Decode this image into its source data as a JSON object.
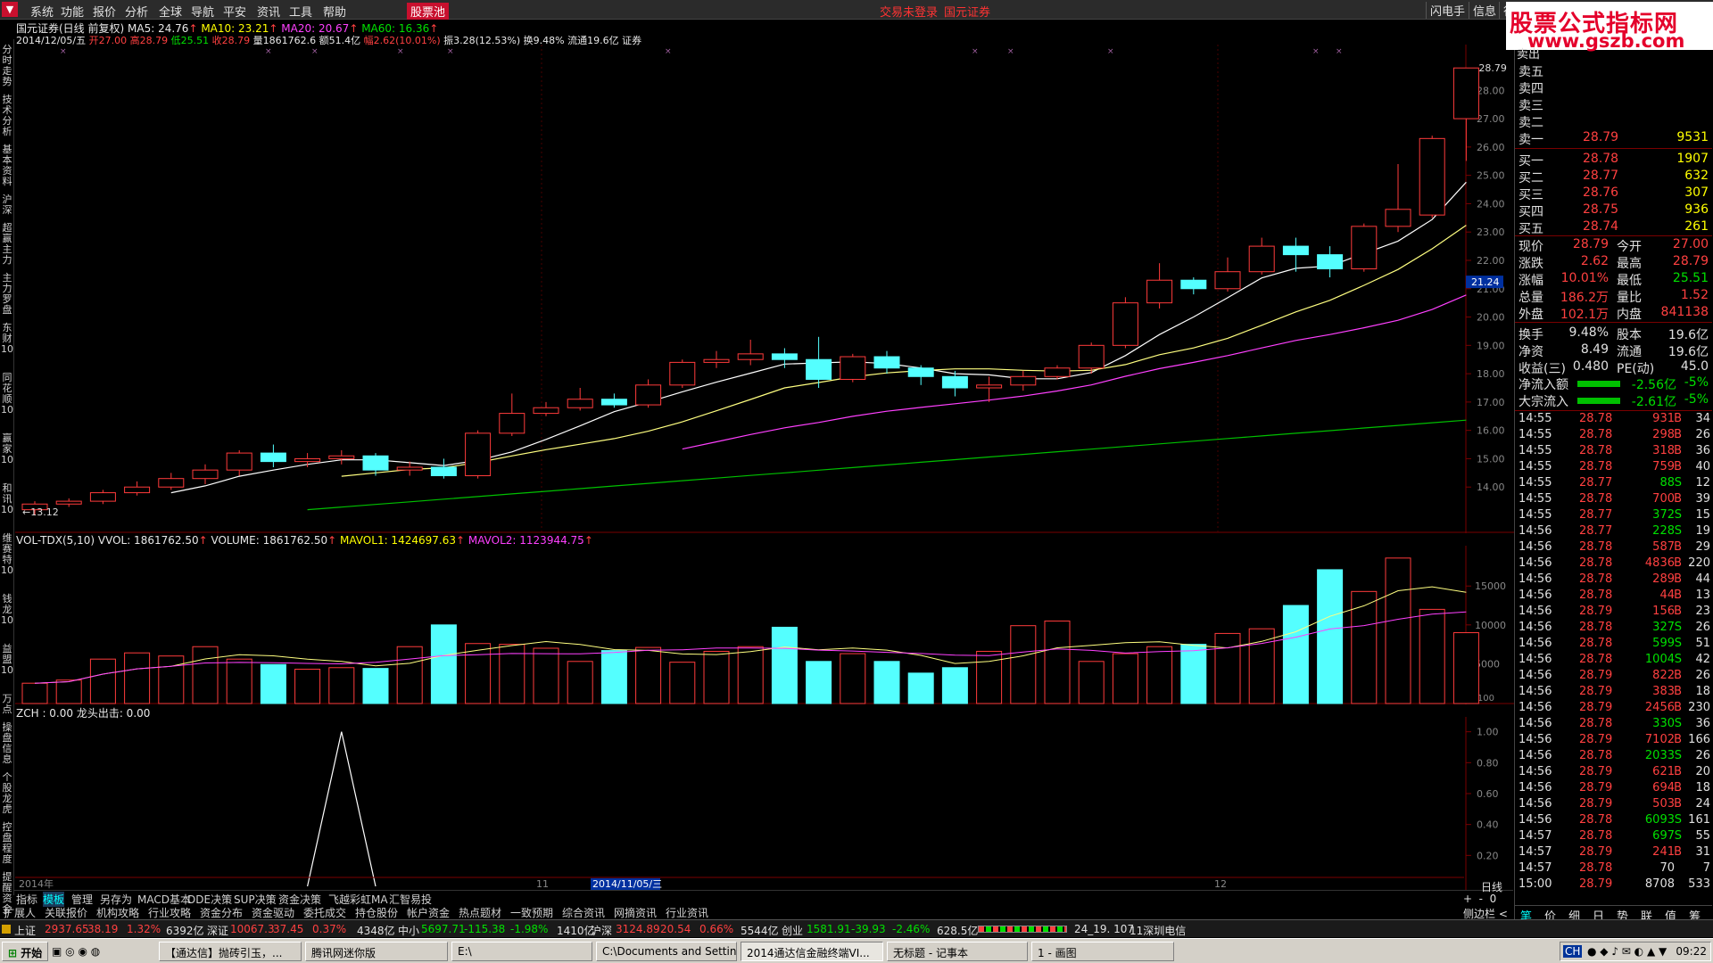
{
  "menu": {
    "items": [
      "系统",
      "功能",
      "报价",
      "分析",
      "全球",
      "导航",
      "平安",
      "资讯",
      "工具",
      "帮助"
    ],
    "active_label": "股票池",
    "status_text": "交易未登录",
    "broker_text": "国元证券",
    "right_buttons": [
      "闪电手",
      "信息",
      "行"
    ]
  },
  "watermark": {
    "line1": "股票公式指标网",
    "line2": "www.gszb.com"
  },
  "stock_header": {
    "name_ma": "国元证券(日线 前复权)",
    "ma5": "MA5: 24.76",
    "ma10": "MA10: 23.21",
    "ma20": "MA20: 20.67",
    "ma60": "MA60: 16.36",
    "date": "2014/12/05/五",
    "open": "开27.00",
    "high": "高28.79",
    "low": "低25.51",
    "close": "收28.79",
    "vol": "量1861762.6",
    "amount": "额51.4亿",
    "change": "幅2.62(10.01%)",
    "amp": "振3.28(12.53%)",
    "turn": "换9.48%",
    "float": "流通19.6亿",
    "sector": "证券"
  },
  "vol_header": {
    "title": "VOL-TDX(5,10)",
    "vvol": "VVOL: 1861762.50",
    "volume": "VOLUME: 1861762.50",
    "mavol1": "MAVOL1: 1424697.63",
    "mavol2": "MAVOL2: 1123944.75"
  },
  "zch_header": {
    "text": "ZCH : 0.00  龙头出击: 0.00"
  },
  "left_tabs": [
    "分时走势",
    "技术分析",
    "基本资料",
    "沪深",
    "超赢主力",
    "主力罗盘",
    "东财10",
    "同花顺10",
    "赢家10",
    "和讯10",
    "维赛特10",
    "钱龙10",
    "益盟10",
    "万点",
    "操盘信息",
    "个股龙虎",
    "控盘程度",
    "提醒资金"
  ],
  "chart_price": {
    "type": "candlestick",
    "y_ticks": [
      "28.00",
      "27.00",
      "26.00",
      "25.00",
      "24.00",
      "23.00",
      "22.00",
      "21.00",
      "20.00",
      "19.00",
      "18.00",
      "17.00",
      "16.00",
      "15.00",
      "14.00"
    ],
    "ylim": [
      13.0,
      29.3
    ],
    "high_label": "28.79",
    "low_label": "←13.12",
    "cursor_label": "21.24",
    "x_labels": [
      "2014年",
      "11",
      "2014/11/05/三",
      "12"
    ],
    "candles": [
      [
        13.2,
        13.4,
        13.0,
        13.5
      ],
      [
        13.4,
        13.5,
        13.3,
        13.6
      ],
      [
        13.5,
        13.8,
        13.4,
        13.9
      ],
      [
        13.8,
        14.0,
        13.7,
        14.2
      ],
      [
        14.0,
        14.3,
        13.9,
        14.5
      ],
      [
        14.3,
        14.6,
        14.1,
        14.8
      ],
      [
        14.6,
        15.2,
        14.4,
        15.3
      ],
      [
        15.2,
        14.9,
        14.7,
        15.5
      ],
      [
        14.9,
        15.0,
        14.7,
        15.2
      ],
      [
        15.0,
        15.1,
        14.8,
        15.3
      ],
      [
        15.1,
        14.6,
        14.4,
        15.2
      ],
      [
        14.6,
        14.7,
        14.4,
        14.9
      ],
      [
        14.7,
        14.4,
        14.3,
        15.0
      ],
      [
        14.4,
        15.9,
        14.3,
        16.0
      ],
      [
        15.9,
        16.6,
        15.8,
        17.3
      ],
      [
        16.6,
        16.8,
        16.5,
        17.0
      ],
      [
        16.8,
        17.1,
        16.7,
        17.5
      ],
      [
        17.1,
        16.9,
        16.8,
        17.3
      ],
      [
        16.9,
        17.6,
        16.8,
        17.8
      ],
      [
        17.6,
        18.4,
        17.5,
        18.5
      ],
      [
        18.4,
        18.5,
        18.2,
        18.8
      ],
      [
        18.5,
        18.7,
        18.3,
        19.2
      ],
      [
        18.7,
        18.5,
        18.2,
        18.9
      ],
      [
        18.5,
        17.8,
        17.5,
        19.3
      ],
      [
        17.8,
        18.6,
        17.7,
        18.7
      ],
      [
        18.6,
        18.2,
        18.0,
        18.8
      ],
      [
        18.2,
        17.9,
        17.6,
        18.3
      ],
      [
        17.9,
        17.5,
        17.2,
        18.1
      ],
      [
        17.5,
        17.6,
        17.0,
        17.9
      ],
      [
        17.6,
        17.9,
        17.4,
        18.1
      ],
      [
        17.9,
        18.2,
        17.8,
        18.3
      ],
      [
        18.2,
        19.0,
        18.0,
        19.1
      ],
      [
        19.0,
        20.5,
        18.9,
        20.7
      ],
      [
        20.5,
        21.3,
        20.3,
        21.9
      ],
      [
        21.3,
        21.0,
        20.8,
        21.4
      ],
      [
        21.0,
        21.6,
        20.9,
        22.1
      ],
      [
        21.6,
        22.5,
        21.5,
        22.8
      ],
      [
        22.5,
        22.2,
        21.6,
        22.8
      ],
      [
        22.2,
        21.7,
        21.4,
        22.5
      ],
      [
        21.7,
        23.2,
        21.6,
        23.3
      ],
      [
        23.2,
        23.8,
        23.0,
        25.4
      ],
      [
        23.6,
        26.3,
        23.5,
        26.4
      ],
      [
        27.0,
        28.79,
        25.51,
        28.79
      ]
    ]
  },
  "chart_volume": {
    "type": "bar",
    "y_ticks": [
      "15000",
      "10000",
      "5000"
    ],
    "unit": "X100",
    "values": [
      2500,
      2900,
      5600,
      6400,
      6000,
      7200,
      5600,
      4900,
      4300,
      4500,
      4400,
      7200,
      10000,
      7600,
      7500,
      7000,
      5300,
      6700,
      7100,
      5200,
      6600,
      7200,
      9700,
      5300,
      6300,
      5300,
      3800,
      4500,
      6600,
      9900,
      10500,
      5300,
      6300,
      7200,
      7500,
      8900,
      9500,
      12500,
      17100,
      14300,
      18600,
      12000,
      9000
    ]
  },
  "chart_zch": {
    "type": "line",
    "y_ticks": [
      "1.00",
      "0.80",
      "0.60",
      "0.40",
      "0.20"
    ]
  },
  "quote": {
    "sell_top": "卖出",
    "sell": [
      {
        "label": "卖五",
        "price": "",
        "vol": ""
      },
      {
        "label": "卖四",
        "price": "",
        "vol": ""
      },
      {
        "label": "卖三",
        "price": "",
        "vol": ""
      },
      {
        "label": "卖二",
        "price": "",
        "vol": ""
      },
      {
        "label": "卖一",
        "price": "28.79",
        "vol": "9531"
      }
    ],
    "buy": [
      {
        "label": "买一",
        "price": "28.78",
        "vol": "1907"
      },
      {
        "label": "买二",
        "price": "28.77",
        "vol": "632"
      },
      {
        "label": "买三",
        "price": "28.76",
        "vol": "307"
      },
      {
        "label": "买四",
        "price": "28.75",
        "vol": "936"
      },
      {
        "label": "买五",
        "price": "28.74",
        "vol": "261"
      }
    ],
    "stats": [
      {
        "l1": "现价",
        "v1": "28.79",
        "l2": "今开",
        "v2": "27.00"
      },
      {
        "l1": "涨跌",
        "v1": "2.62",
        "l2": "最高",
        "v2": "28.79"
      },
      {
        "l1": "涨幅",
        "v1": "10.01%",
        "l2": "最低",
        "v2": "25.51"
      },
      {
        "l1": "总量",
        "v1": "186.2万",
        "l2": "量比",
        "v2": "1.52"
      },
      {
        "l1": "外盘",
        "v1": "102.1万",
        "l2": "内盘",
        "v2": "841138"
      },
      {
        "l1": "换手",
        "v1": "9.48%",
        "l2": "股本",
        "v2": "19.6亿"
      },
      {
        "l1": "净资",
        "v1": "8.49",
        "l2": "流通",
        "v2": "19.6亿"
      },
      {
        "l1": "收益(三)",
        "v1": "0.480",
        "l2": "PE(动)",
        "v2": "45.0"
      }
    ],
    "flow": [
      {
        "label": "净流入额",
        "value": "-2.56亿",
        "pct": "-5%"
      },
      {
        "label": "大宗流入",
        "value": "-2.61亿",
        "pct": "-5%"
      }
    ],
    "ticks": [
      [
        "14:55",
        "28.78",
        "931",
        "B",
        "34"
      ],
      [
        "14:55",
        "28.78",
        "298",
        "B",
        "26"
      ],
      [
        "14:55",
        "28.78",
        "318",
        "B",
        "36"
      ],
      [
        "14:55",
        "28.78",
        "759",
        "B",
        "40"
      ],
      [
        "14:55",
        "28.77",
        "88",
        "S",
        "12"
      ],
      [
        "14:55",
        "28.78",
        "700",
        "B",
        "39"
      ],
      [
        "14:55",
        "28.77",
        "372",
        "S",
        "15"
      ],
      [
        "14:56",
        "28.77",
        "228",
        "S",
        "19"
      ],
      [
        "14:56",
        "28.78",
        "587",
        "B",
        "29"
      ],
      [
        "14:56",
        "28.78",
        "4836",
        "B",
        "220"
      ],
      [
        "14:56",
        "28.78",
        "289",
        "B",
        "44"
      ],
      [
        "14:56",
        "28.78",
        "44",
        "B",
        "13"
      ],
      [
        "14:56",
        "28.79",
        "156",
        "B",
        "23"
      ],
      [
        "14:56",
        "28.78",
        "327",
        "S",
        "26"
      ],
      [
        "14:56",
        "28.78",
        "599",
        "S",
        "51"
      ],
      [
        "14:56",
        "28.78",
        "1004",
        "S",
        "42"
      ],
      [
        "14:56",
        "28.79",
        "822",
        "B",
        "26"
      ],
      [
        "14:56",
        "28.79",
        "383",
        "B",
        "18"
      ],
      [
        "14:56",
        "28.79",
        "2456",
        "B",
        "230"
      ],
      [
        "14:56",
        "28.78",
        "330",
        "S",
        "36"
      ],
      [
        "14:56",
        "28.79",
        "7102",
        "B",
        "166"
      ],
      [
        "14:56",
        "28.78",
        "2033",
        "S",
        "26"
      ],
      [
        "14:56",
        "28.79",
        "621",
        "B",
        "20"
      ],
      [
        "14:56",
        "28.79",
        "694",
        "B",
        "18"
      ],
      [
        "14:56",
        "28.79",
        "503",
        "B",
        "24"
      ],
      [
        "14:56",
        "28.78",
        "6093",
        "S",
        "161"
      ],
      [
        "14:57",
        "28.78",
        "697",
        "S",
        "55"
      ],
      [
        "14:57",
        "28.79",
        "241",
        "B",
        "31"
      ],
      [
        "14:57",
        "28.78",
        "70",
        "",
        "7"
      ],
      [
        "15:00",
        "28.79",
        "8708",
        "",
        "533"
      ]
    ],
    "bottom_tabs": [
      "笔",
      "价",
      "细",
      "日",
      "势",
      "联",
      "值",
      "筹"
    ]
  },
  "tabs_row1": [
    "指标",
    "模板",
    "管理",
    "另存为",
    "MACD基本",
    "DDE决策",
    "SUP决策",
    "资金决策",
    "飞越彩虹MA",
    "汇智易投"
  ],
  "tabs_row1_selected": "模板",
  "tabs_row2": [
    "扩展人",
    "关联报价",
    "机构攻略",
    "行业攻略",
    "资金分布",
    "资金驱动",
    "委托成交",
    "持仓股份",
    "帐户资金",
    "热点题材",
    "一致预期",
    "综合资讯",
    "网摘资讯",
    "行业资讯"
  ],
  "period_label": "日线",
  "sidebar_label": "侧边栏",
  "statusbar": {
    "sh": "上证",
    "sh_val": "2937.65",
    "sh_chg": "38.19",
    "sh_pct": "1.32%",
    "sh_amt": "6392亿",
    "sz": "深证",
    "sz_val": "10067.3",
    "sz_chg": "37.45",
    "sz_pct": "0.37%",
    "sz_amt": "4348亿",
    "zx": "中小",
    "zx_val": "5697.71",
    "zx_chg": "-115.38",
    "zx_pct": "-1.98%",
    "zx_amt": "1410亿",
    "hs": "沪深",
    "hs_val": "3124.89",
    "hs_chg": "20.54",
    "hs_pct": "0.66%",
    "hs_amt": "5544亿",
    "cy": "创业",
    "cy_val": "1581.91",
    "cy_chg": "-39.93",
    "cy_pct": "-2.46%",
    "cy_amt": "628.5亿",
    "server": "24_19. 107",
    "line": "11深圳电信"
  },
  "taskbar": {
    "start": "开始",
    "buttons": [
      "【通达信】抛砖引玉，...",
      "腾讯网迷你版",
      "E:\\",
      "C:\\Documents and Settin...",
      "2014通达信金融终端VI...",
      "无标题 - 记事本",
      "1 - 画图"
    ],
    "tray_lang": "CH",
    "clock": "09:22"
  },
  "colors": {
    "up": "#ff3b3b",
    "down": "#54ffff",
    "ma5": "#ffffff",
    "ma10": "#ffff80",
    "ma20": "#ff40ff",
    "ma60": "#00c000"
  }
}
